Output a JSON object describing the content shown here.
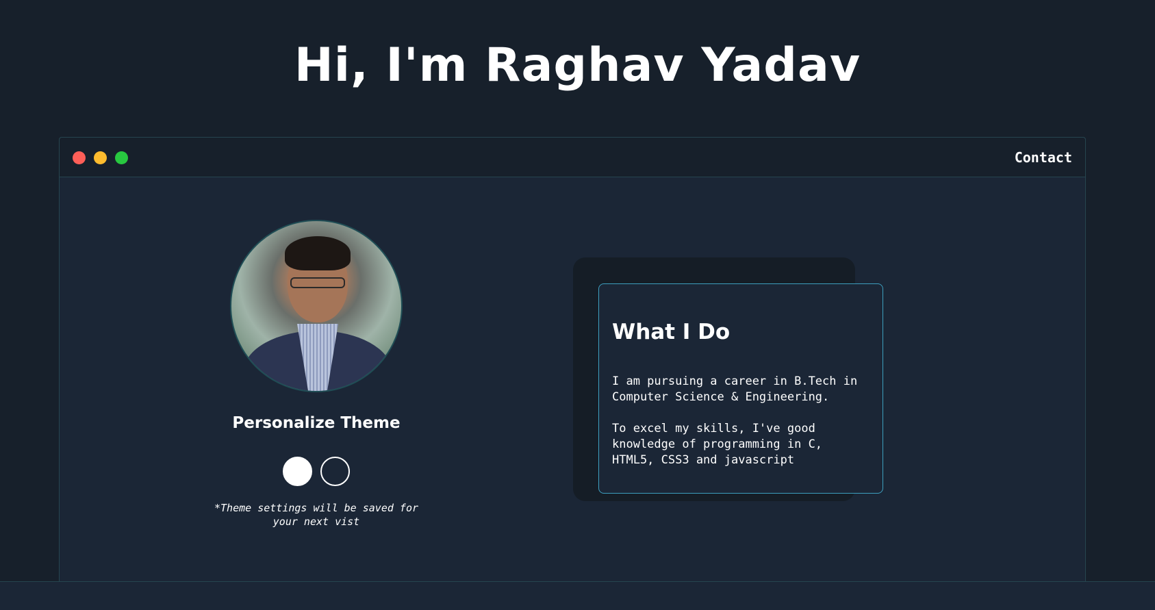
{
  "header": {
    "title": "Hi, I'm Raghav Yadav"
  },
  "window": {
    "controls": [
      "close",
      "minimize",
      "maximize"
    ],
    "colors": {
      "close": "#fe5f58",
      "minimize": "#febc2e",
      "maximize": "#28c840"
    },
    "nav": {
      "contact_label": "Contact"
    }
  },
  "profile": {
    "avatar": "profile-photo",
    "theme": {
      "title": "Personalize Theme",
      "options": [
        "light",
        "dark"
      ],
      "note_line1": "*Theme settings will be saved for",
      "note_line2": "your next vist"
    }
  },
  "about": {
    "title": "What I Do",
    "paragraph1_line1": "I am pursuing a career in B.Tech in",
    "paragraph1_line2": "Computer Science & Engineering.",
    "paragraph2_line1": "To excel my skills, I've good",
    "paragraph2_line2": "knowledge of programming in C,",
    "paragraph2_line3": "HTML5, CSS3 and javascript"
  },
  "colors": {
    "background": "#17202b",
    "panel": "#1b2636",
    "accent_border": "#3d9fbf"
  }
}
